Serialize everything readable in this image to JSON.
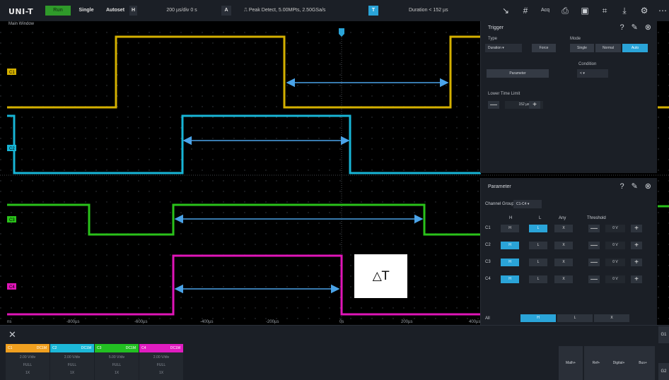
{
  "toolbar": {
    "logo": "UNI-T",
    "run_label": "Run",
    "single_label": "Single",
    "autoset_label": "Autoset",
    "h_label": "H",
    "timebase": "200 µs/div  0 s",
    "a_label": "A",
    "acquisition": "Peak Detect, 5.00MPts, 2.50GSa/s",
    "t_label": "T",
    "duration": "Duration  <  152 µs"
  },
  "icons": [
    "cursor-icon",
    "grid-icon",
    "acq-icon",
    "print-icon",
    "save-icon",
    "measure-icon",
    "download-icon",
    "settings-icon"
  ],
  "main_window_label": "Main Window",
  "trigger_panel": {
    "title": "Trigger",
    "type_label": "Type",
    "type_value": "Duration",
    "force_label": "Force",
    "mode_label": "Mode",
    "mode_options": [
      "Single",
      "Normal",
      "Auto"
    ],
    "mode_selected": "Auto",
    "condition_label": "Condition",
    "condition_value": "<",
    "parameter_button": "Parameter",
    "lower_time_label": "Lower Time Limit",
    "lower_time_value": "152 µs",
    "minus": "—",
    "plus": "+"
  },
  "param_panel": {
    "title": "Parameter",
    "channel_group_label": "Channel Group",
    "channel_group_value": "C1-C4",
    "col_headers": [
      "H",
      "L",
      "Any",
      "Threshold"
    ],
    "rows": [
      {
        "label": "C1",
        "h": "H",
        "l": "L",
        "x": "X",
        "selected": "L",
        "threshold": "0 V"
      },
      {
        "label": "C2",
        "h": "H",
        "l": "L",
        "x": "X",
        "selected": "H",
        "threshold": "0 V"
      },
      {
        "label": "C3",
        "h": "H",
        "l": "L",
        "x": "X",
        "selected": "H",
        "threshold": "0 V"
      },
      {
        "label": "C4",
        "h": "H",
        "l": "L",
        "x": "X",
        "selected": "H",
        "threshold": "0 V"
      }
    ],
    "all_label": "All",
    "all_options": [
      "H",
      "L",
      "X"
    ],
    "minus": "—",
    "plus": "+"
  },
  "delta_label": "△T",
  "time_axis": [
    "ns",
    "-800µs",
    "-600µs",
    "-400µs",
    "-200µs",
    "0s",
    "200µs",
    "400µs"
  ],
  "channel_markers": [
    "C1",
    "C2",
    "C3",
    "C4"
  ],
  "channels": [
    {
      "name": "C1",
      "coupling": "DC1M",
      "scale": "2.00 V/div",
      "bw": "FULL",
      "probe": "1X",
      "color": "#f0a020"
    },
    {
      "name": "C2",
      "coupling": "DC1M",
      "scale": "2.00 V/div",
      "bw": "FULL",
      "probe": "1X",
      "color": "#1cb8d8"
    },
    {
      "name": "C3",
      "coupling": "DC1M",
      "scale": "5.00 V/div",
      "bw": "FULL",
      "probe": "1X",
      "color": "#22c022"
    },
    {
      "name": "C4",
      "coupling": "DC1M",
      "scale": "2.00 V/div",
      "bw": "FULL",
      "probe": "1X",
      "color": "#e01cc0"
    }
  ],
  "bottom_buttons": [
    "Math+",
    "Ref+",
    "Digital+",
    "Bus+"
  ],
  "side_buttons": [
    "G1",
    "G2"
  ],
  "colors": {
    "c1": "#d4b000",
    "c2": "#17b5d6",
    "c3": "#2ac21a",
    "c4": "#e015b8",
    "accent": "#2aa4d8",
    "arrow": "#4aa3e8"
  }
}
